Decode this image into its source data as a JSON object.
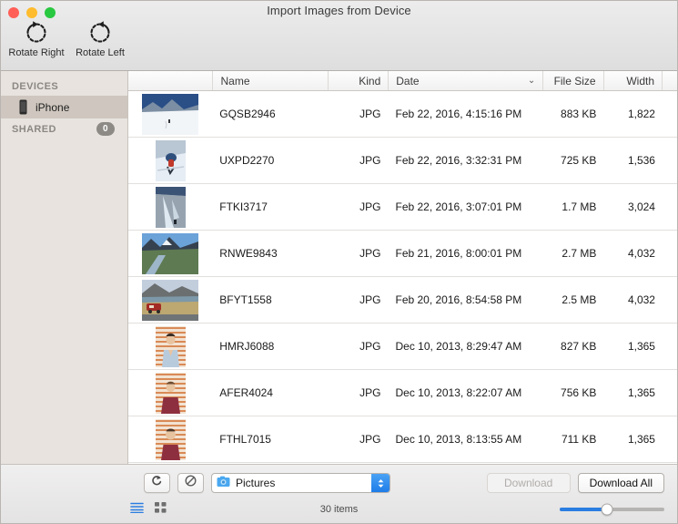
{
  "window": {
    "title": "Import Images from Device",
    "traffic_lights": [
      {
        "name": "close",
        "color": "#ff5f57"
      },
      {
        "name": "minimize",
        "color": "#febc2e"
      },
      {
        "name": "zoom",
        "color": "#28c840"
      }
    ]
  },
  "toolbar": {
    "items": [
      {
        "icon": "rotate-right-icon",
        "label": "Rotate Right"
      },
      {
        "icon": "rotate-left-icon",
        "label": "Rotate Left"
      }
    ]
  },
  "sidebar": {
    "sections": [
      {
        "header": "DEVICES",
        "badge": null,
        "rows": [
          {
            "icon": "iphone-icon",
            "label": "iPhone",
            "selected": true
          }
        ]
      },
      {
        "header": "SHARED",
        "badge": "0",
        "rows": []
      }
    ]
  },
  "table": {
    "columns": [
      {
        "key": "thumb",
        "label": ""
      },
      {
        "key": "name",
        "label": "Name"
      },
      {
        "key": "kind",
        "label": "Kind"
      },
      {
        "key": "date",
        "label": "Date"
      },
      {
        "key": "size",
        "label": "File Size"
      },
      {
        "key": "width",
        "label": "Width"
      }
    ],
    "sorted_column": "Date",
    "sort_indicator": "⌄",
    "rows": [
      {
        "name": "GQSB2946",
        "kind": "JPG",
        "date": "Feb 22, 2016, 4:15:16 PM",
        "size": "883 KB",
        "width": "1,822",
        "thumb": "snow-mountain-landscape",
        "orient": "land"
      },
      {
        "name": "UXPD2270",
        "kind": "JPG",
        "date": "Feb 22, 2016, 3:32:31 PM",
        "size": "725 KB",
        "width": "1,536",
        "thumb": "climber-on-snow-portrait",
        "orient": "port"
      },
      {
        "name": "FTKI3717",
        "kind": "JPG",
        "date": "Feb 22, 2016, 3:07:01 PM",
        "size": "1.7 MB",
        "width": "3,024",
        "thumb": "glacier-crevasse-portrait",
        "orient": "port"
      },
      {
        "name": "RNWE9843",
        "kind": "JPG",
        "date": "Feb 21, 2016, 8:00:01 PM",
        "size": "2.7 MB",
        "width": "4,032",
        "thumb": "mountain-river-valley",
        "orient": "land"
      },
      {
        "name": "BFYT1558",
        "kind": "JPG",
        "date": "Feb 20, 2016, 8:54:58 PM",
        "size": "2.5 MB",
        "width": "4,032",
        "thumb": "red-van-by-lake",
        "orient": "land"
      },
      {
        "name": "HMRJ6088",
        "kind": "JPG",
        "date": "Dec 10, 2013, 8:29:47 AM",
        "size": "827 KB",
        "width": "1,365",
        "thumb": "portrait-person-blue-shirt",
        "orient": "port"
      },
      {
        "name": "AFER4024",
        "kind": "JPG",
        "date": "Dec 10, 2013, 8:22:07 AM",
        "size": "756 KB",
        "width": "1,365",
        "thumb": "portrait-person-maroon-shirt",
        "orient": "port"
      },
      {
        "name": "FTHL7015",
        "kind": "JPG",
        "date": "Dec 10, 2013, 8:13:55 AM",
        "size": "711 KB",
        "width": "1,365",
        "thumb": "portrait-person-maroon-shirt-2",
        "orient": "port"
      }
    ]
  },
  "bottom": {
    "rotate_button_icon": "rotate-icon",
    "delete_button_icon": "prohibited-icon",
    "destination": {
      "icon": "pictures-folder-icon",
      "value": "Pictures"
    },
    "download_label": "Download",
    "download_enabled": false,
    "download_all_label": "Download All",
    "download_all_enabled": true,
    "view_list_icon": "list-view-icon",
    "view_grid_icon": "grid-view-icon",
    "active_view": "list",
    "items_count": "30 items",
    "zoom_slider_percent": 45
  },
  "colors": {
    "accent": "#2a7de1",
    "sidebar_bg": "#e8e3de",
    "sidebar_selected": "#cfc7bf",
    "toolbar_bg": "#e6e4e2"
  }
}
